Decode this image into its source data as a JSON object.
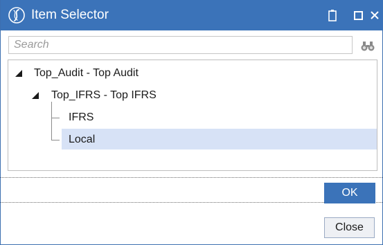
{
  "window": {
    "title": "Item Selector"
  },
  "colors": {
    "titlebar": "#3b73b9",
    "selection": "#d7e2f6",
    "ok_button": "#3b73b9"
  },
  "search": {
    "placeholder": "Search",
    "value": ""
  },
  "tree": {
    "nodes": [
      {
        "label": "Top_Audit - Top Audit",
        "level": 0,
        "expanded": true
      },
      {
        "label": "Top_IFRS - Top IFRS",
        "level": 1,
        "expanded": true
      },
      {
        "label": "IFRS",
        "level": 2
      },
      {
        "label": "Local",
        "level": 2,
        "selected": true
      }
    ]
  },
  "buttons": {
    "ok": "OK",
    "close": "Close"
  },
  "icons": {
    "logo": "app-logo-icon",
    "clipboard": "clipboard-icon",
    "maximize": "maximize-icon",
    "close": "close-icon",
    "find": "binoculars-icon",
    "expander": "expanded-triangle-icon"
  }
}
